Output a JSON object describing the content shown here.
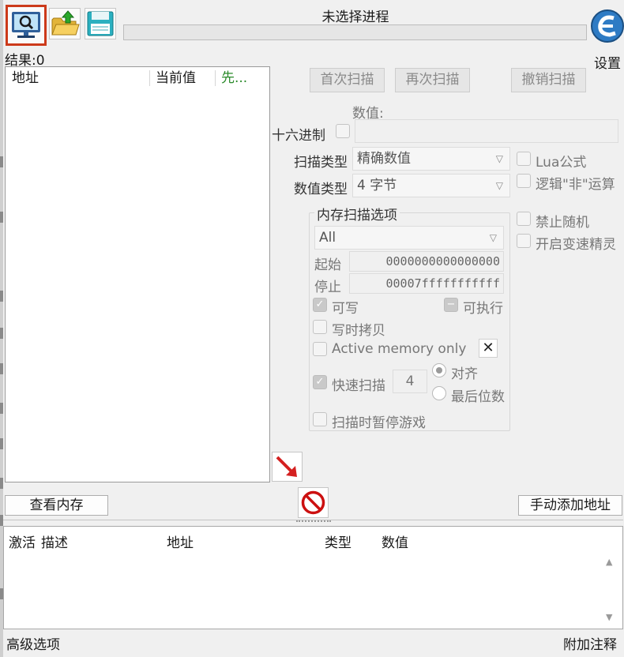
{
  "window": {
    "title": "未选择进程",
    "settings_label": "设置"
  },
  "toolbar": {
    "open_process_icon": "computer-magnifier-icon",
    "open_file_icon": "folder-open-icon",
    "save_icon": "floppy-disk-icon",
    "logo_icon": "cheat-engine-logo"
  },
  "result": {
    "label": "结果:0"
  },
  "found_list": {
    "columns": [
      "地址",
      "当前值",
      "先..."
    ]
  },
  "scan_buttons": {
    "first_scan": "首次扫描",
    "next_scan": "再次扫描",
    "undo_scan": "撤销扫描"
  },
  "value": {
    "label": "数值:",
    "hex_label": "十六进制"
  },
  "scan_type": {
    "label": "扫描类型",
    "selected": "精确数值"
  },
  "value_type": {
    "label": "数值类型",
    "selected": "4 字节"
  },
  "options_right": {
    "lua_formula": "Lua公式",
    "logical_not": "逻辑\"非\"运算",
    "no_random": "禁止随机",
    "speedhack": "开启变速精灵"
  },
  "memory_scan": {
    "title": "内存扫描选项",
    "region_selected": "All",
    "start_label": "起始",
    "start_value": "0000000000000000",
    "stop_label": "停止",
    "stop_value": "00007fffffffffff",
    "writable": "可写",
    "executable": "可执行",
    "copy_on_write": "写时拷贝",
    "active_memory_only": "Active memory only",
    "fast_scan": "快速扫描",
    "fast_scan_value": "4",
    "alignment": "对齐",
    "last_digits": "最后位数",
    "pause_game": "扫描时暂停游戏"
  },
  "actions": {
    "view_memory": "查看内存",
    "add_address_manually": "手动添加地址"
  },
  "cheat_table": {
    "columns": [
      "激活",
      "描述",
      "地址",
      "类型",
      "数值"
    ]
  },
  "status_bar": {
    "advanced_options": "高级选项",
    "table_comments": "附加注释"
  },
  "colors": {
    "active_tool_border": "#cc3a1a",
    "arrow_red": "#d42020",
    "stop_red": "#cc1010",
    "previous_column_green": "#2a8a2a"
  }
}
